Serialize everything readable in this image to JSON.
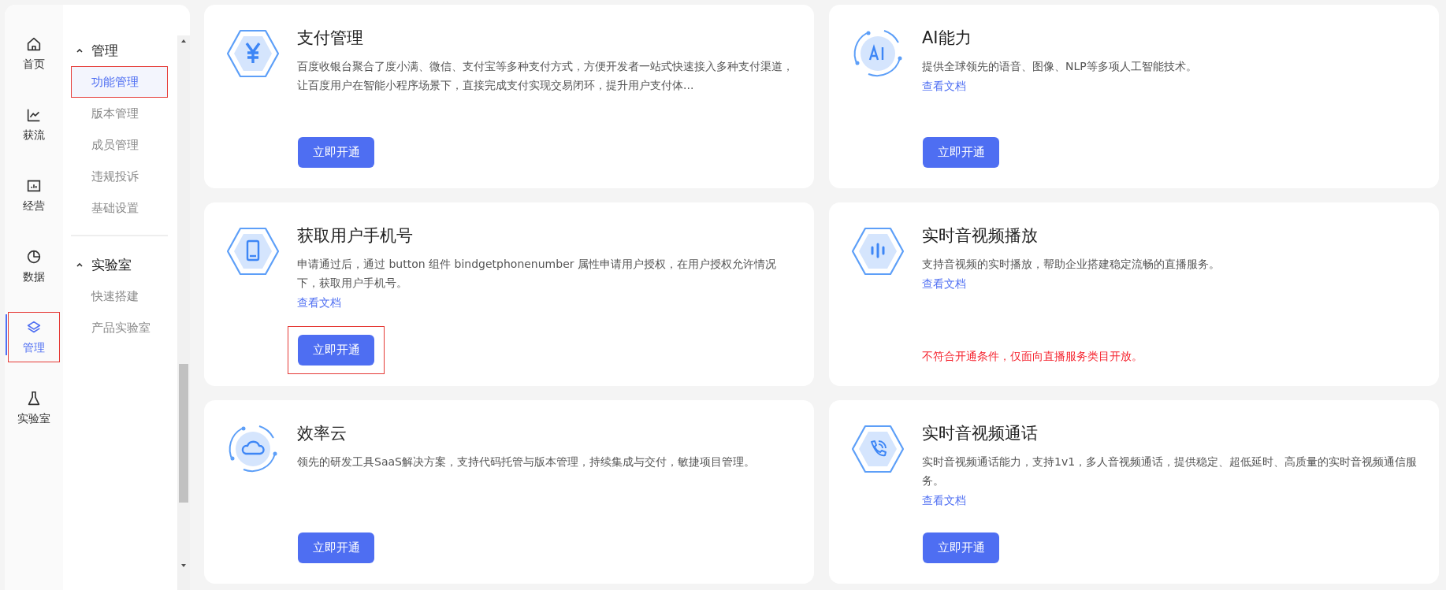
{
  "rail": [
    {
      "label": "首页",
      "kind": "home",
      "selected": false,
      "highlighted": false
    },
    {
      "label": "获流",
      "kind": "chart",
      "selected": false,
      "highlighted": false
    },
    {
      "label": "经营",
      "kind": "board",
      "selected": false,
      "highlighted": false
    },
    {
      "label": "数据",
      "kind": "pie",
      "selected": false,
      "highlighted": false
    },
    {
      "label": "管理",
      "kind": "layers",
      "selected": true,
      "highlighted": true
    },
    {
      "label": "实验室",
      "kind": "flask",
      "selected": false,
      "highlighted": false
    }
  ],
  "submenu": [
    {
      "title": "管理",
      "expanded": true,
      "items": [
        {
          "label": "功能管理",
          "selected": true,
          "highlighted": true
        },
        {
          "label": "版本管理",
          "selected": false,
          "highlighted": false
        },
        {
          "label": "成员管理",
          "selected": false,
          "highlighted": false
        },
        {
          "label": "违规投诉",
          "selected": false,
          "highlighted": false
        },
        {
          "label": "基础设置",
          "selected": false,
          "highlighted": false
        }
      ]
    },
    {
      "title": "实验室",
      "expanded": true,
      "items": [
        {
          "label": "快速搭建",
          "selected": false,
          "highlighted": false
        },
        {
          "label": "产品实验室",
          "selected": false,
          "highlighted": false
        }
      ]
    }
  ],
  "cards": [
    {
      "kind": "yen",
      "title": "支付管理",
      "description": "百度收银台聚合了度小满、微信、支付宝等多种支付方式，方便开发者一站式快速接入多种支付渠道，让百度用户在智能小程序场景下，直接完成支付实现交易闭环，提升用户支付体...",
      "button": "立即开通",
      "button_highlighted": false
    },
    {
      "kind": "ai",
      "title": "AI能力",
      "description": "提供全球领先的语音、图像、NLP等多项人工智能技术。",
      "doc_link": "查看文档",
      "button": "立即开通",
      "button_highlighted": false
    },
    {
      "kind": "phone",
      "title": "获取用户手机号",
      "description": "申请通过后，通过 button 组件 bindgetphonenumber 属性申请用户授权，在用户授权允许情况下，获取用户手机号。",
      "doc_link": "查看文档",
      "button": "立即开通",
      "button_highlighted": true
    },
    {
      "kind": "wave",
      "title": "实时音视频播放",
      "description": "支持音视频的实时播放，帮助企业搭建稳定流畅的直播服务。",
      "doc_link": "查看文档",
      "notice": "不符合开通条件，仅面向直播服务类目开放。"
    },
    {
      "kind": "cloud",
      "title": "效率云",
      "description": "领先的研发工具SaaS解决方案，支持代码托管与版本管理，持续集成与交付，敏捷项目管理。",
      "button": "立即开通",
      "button_highlighted": false
    },
    {
      "kind": "call",
      "title": "实时音视频通话",
      "description": "实时音视频通话能力，支持1v1，多人音视频通话，提供稳定、超低延时、高质量的实时音视频通信服务。",
      "doc_link": "查看文档",
      "button": "立即开通",
      "button_highlighted": false
    }
  ]
}
